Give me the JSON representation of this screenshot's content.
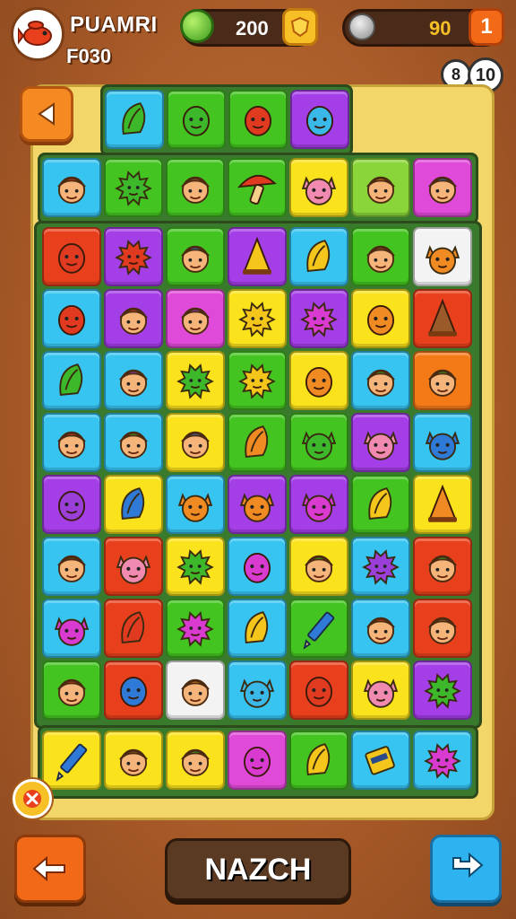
{
  "hud": {
    "title": "PUAMRI",
    "subtitle": "F030",
    "gems": "200",
    "coins": "90",
    "lives": "1",
    "moves_a": "8",
    "moves_b": "10"
  },
  "main_button_label": "NAZCH",
  "colors": {
    "red": "#e8401c",
    "green": "#44c421",
    "cyan": "#38c4f0",
    "purple": "#a43ee6",
    "yellow": "#fae21c",
    "orange": "#f47a18",
    "magenta": "#e04ad8",
    "white": "#f3f3f3",
    "lime": "#8ad63a"
  },
  "grid": {
    "top_row": [
      {
        "color": "cyan",
        "icon": "green-leaf-face"
      },
      {
        "color": "green",
        "icon": "green-blob-face"
      },
      {
        "color": "green",
        "icon": "red-bird-face"
      },
      {
        "color": "purple",
        "icon": "cyan-drop-face"
      }
    ],
    "second_row": [
      {
        "color": "cyan",
        "icon": "red-hat-boy"
      },
      {
        "color": "green",
        "icon": "green-spiky-face"
      },
      {
        "color": "green",
        "icon": "brown-hair-kid"
      },
      {
        "color": "green",
        "icon": "red-mushroom"
      },
      {
        "color": "yellow",
        "icon": "pink-ear-cat"
      },
      {
        "color": "lime",
        "icon": "orange-bun-kid"
      },
      {
        "color": "magenta",
        "icon": "blue-cap-kid"
      }
    ],
    "rows": [
      [
        {
          "color": "red",
          "icon": "red-bell-face"
        },
        {
          "color": "purple",
          "icon": "red-spiky-face"
        },
        {
          "color": "green",
          "icon": "blue-cap-kid"
        },
        {
          "color": "purple",
          "icon": "yellow-flame"
        },
        {
          "color": "cyan",
          "icon": "yellow-shell"
        },
        {
          "color": "green",
          "icon": "brown-kid"
        },
        {
          "color": "white",
          "icon": "orange-bear"
        }
      ],
      [
        {
          "color": "cyan",
          "icon": "red-bird"
        },
        {
          "color": "purple",
          "icon": "red-hat-kid"
        },
        {
          "color": "magenta",
          "icon": "purple-cap-kid"
        },
        {
          "color": "yellow",
          "icon": "yellow-sun-face"
        },
        {
          "color": "purple",
          "icon": "magenta-spiky-face"
        },
        {
          "color": "yellow",
          "icon": "orange-fish"
        },
        {
          "color": "red",
          "icon": "brown-cone"
        }
      ],
      [
        {
          "color": "cyan",
          "icon": "green-leaf-face"
        },
        {
          "color": "cyan",
          "icon": "purple-hat-kid"
        },
        {
          "color": "yellow",
          "icon": "green-spiky-face"
        },
        {
          "color": "green",
          "icon": "yellow-sun-face"
        },
        {
          "color": "yellow",
          "icon": "orange-bird"
        },
        {
          "color": "cyan",
          "icon": "green-hair-kid"
        },
        {
          "color": "orange",
          "icon": "green-cap-kid"
        }
      ],
      [
        {
          "color": "cyan",
          "icon": "red-cap-kid"
        },
        {
          "color": "cyan",
          "icon": "green-crown-kid"
        },
        {
          "color": "yellow",
          "icon": "blue-cap-kid"
        },
        {
          "color": "green",
          "icon": "orange-leaf"
        },
        {
          "color": "green",
          "icon": "green-eared-face"
        },
        {
          "color": "purple",
          "icon": "pink-cat-face"
        },
        {
          "color": "cyan",
          "icon": "blue-eared-face"
        }
      ],
      [
        {
          "color": "purple",
          "icon": "purple-egg-face"
        },
        {
          "color": "yellow",
          "icon": "blue-pot"
        },
        {
          "color": "cyan",
          "icon": "orange-cat-face"
        },
        {
          "color": "purple",
          "icon": "orange-cat-face"
        },
        {
          "color": "purple",
          "icon": "magenta-bug-face"
        },
        {
          "color": "green",
          "icon": "yellow-leaf-face"
        },
        {
          "color": "yellow",
          "icon": "orange-cone"
        }
      ],
      [
        {
          "color": "cyan",
          "icon": "dark-hair-kid"
        },
        {
          "color": "red",
          "icon": "pink-pig-face"
        },
        {
          "color": "yellow",
          "icon": "green-spiky-face"
        },
        {
          "color": "cyan",
          "icon": "magenta-drop-face"
        },
        {
          "color": "yellow",
          "icon": "green-hair-kid"
        },
        {
          "color": "cyan",
          "icon": "purple-fuzzy-face"
        },
        {
          "color": "red",
          "icon": "green-cap-kid"
        }
      ],
      [
        {
          "color": "cyan",
          "icon": "magenta-eared-face"
        },
        {
          "color": "red",
          "icon": "red-leaves"
        },
        {
          "color": "green",
          "icon": "magenta-spiky-face"
        },
        {
          "color": "cyan",
          "icon": "yellow-shell"
        },
        {
          "color": "green",
          "icon": "blue-pencil"
        },
        {
          "color": "cyan",
          "icon": "red-cap-kid"
        },
        {
          "color": "red",
          "icon": "brown-hair-girl"
        }
      ],
      [
        {
          "color": "green",
          "icon": "red-cap-kid"
        },
        {
          "color": "red",
          "icon": "blue-wing-face"
        },
        {
          "color": "white",
          "icon": "orange-bun-kid"
        },
        {
          "color": "cyan",
          "icon": "cyan-cat-face"
        },
        {
          "color": "red",
          "icon": "red-round-face"
        },
        {
          "color": "yellow",
          "icon": "pink-cat-face"
        },
        {
          "color": "purple",
          "icon": "green-spiky-face"
        }
      ]
    ],
    "bottom_row": [
      {
        "color": "yellow",
        "icon": "blue-pencil"
      },
      {
        "color": "yellow",
        "icon": "brown-hair-kid"
      },
      {
        "color": "yellow",
        "icon": "green-hair-kid"
      },
      {
        "color": "magenta",
        "icon": "magenta-egg-face"
      },
      {
        "color": "green",
        "icon": "yellow-shell"
      },
      {
        "color": "cyan",
        "icon": "yellow-battery"
      },
      {
        "color": "cyan",
        "icon": "magenta-spiky-face"
      }
    ]
  }
}
